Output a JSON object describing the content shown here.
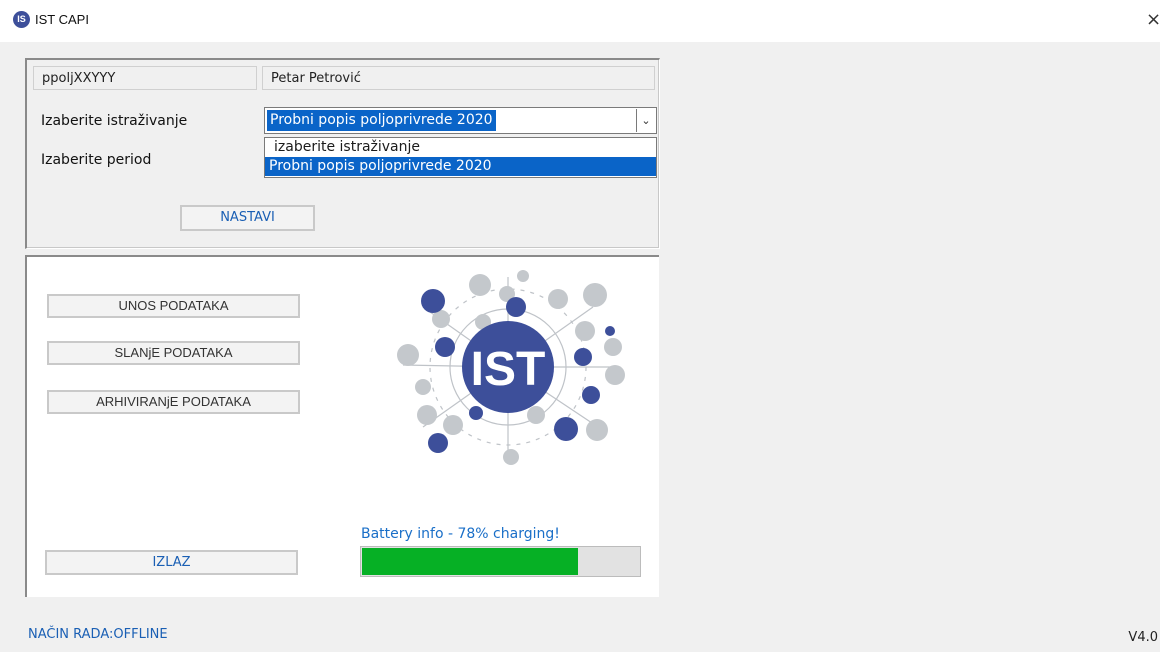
{
  "window": {
    "title": "IST CAPI",
    "close_glyph": "×",
    "icon": "ist-app-icon"
  },
  "user": {
    "username": "ppoljXXYYY",
    "full_name": "Petar Petrović"
  },
  "form": {
    "survey_label": "Izaberite istraživanje",
    "period_label": "Izaberite period",
    "survey_selected": "Probni popis poljoprivrede 2020",
    "survey_options": [
      "izaberite istraživanje",
      "Probni popis poljoprivrede 2020"
    ],
    "continue_button": "NASTAVI"
  },
  "menu": {
    "data_entry_button": "UNOS PODATAKA",
    "data_send_button": "SLANjE PODATAKA",
    "data_archive_button": "ARHIVIRANjE PODATAKA",
    "exit_button": "IZLAZ"
  },
  "logo": {
    "text": "IST"
  },
  "battery": {
    "label": "Battery info - 78% charging!",
    "level_percent": 78,
    "fill_color": "#06b025"
  },
  "status": {
    "mode": "NAČIN RADA:OFFLINE",
    "version": "V4.0"
  },
  "colors": {
    "accent_blue": "#1a5fb4",
    "selection_blue": "#0a64c8",
    "logo_dark": "#3d4f9a",
    "logo_light": "#c4c8cc"
  }
}
